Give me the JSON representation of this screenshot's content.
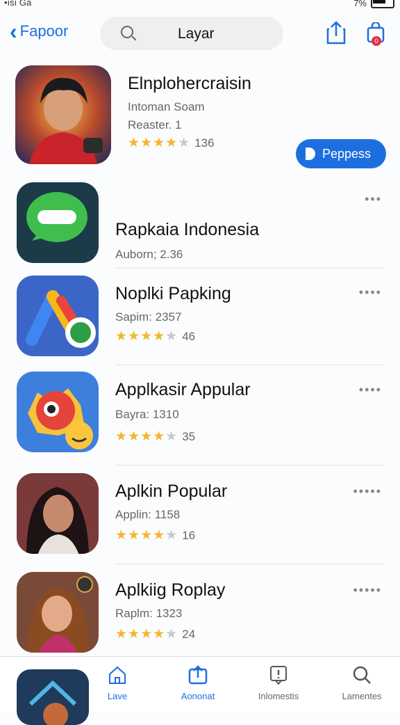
{
  "status": {
    "left_text": "•ısı Ga",
    "battery": "7%"
  },
  "nav": {
    "back_label": "Fapoor",
    "search_text": "Layar",
    "badge": "0"
  },
  "featured": {
    "title": "Elnplohercraisin",
    "subtitle": "Intoman Soam",
    "meta": "Reaster. 1",
    "rating_count": "136",
    "cta_label": "Peppess",
    "stars": 4
  },
  "apps": [
    {
      "title": "Rapkaia Indonesia",
      "subtitle": "Auborn; 2.36",
      "rating_count": "",
      "stars": 0,
      "more": "•••"
    },
    {
      "title": "Noplki Papking",
      "subtitle": "Sapim: 2357",
      "rating_count": "46",
      "stars": 4,
      "more": "••••"
    },
    {
      "title": "Applkasir Appular",
      "subtitle": "Bayra: 1310",
      "rating_count": "35",
      "stars": 4,
      "more": "••••"
    },
    {
      "title": "Aplkin Popular",
      "subtitle": "Applin: 1158",
      "rating_count": "16",
      "stars": 4,
      "more": "•••••"
    },
    {
      "title": "Aplkiig Roplay",
      "subtitle": "Raplm: 1323",
      "rating_count": "24",
      "stars": 4,
      "more": "•••••"
    }
  ],
  "tabs": [
    {
      "label": "Lave",
      "icon": "home-icon"
    },
    {
      "label": "Aononat",
      "icon": "share-icon"
    },
    {
      "label": "Inlomestis",
      "icon": "alert-icon"
    },
    {
      "label": "Lamentes",
      "icon": "search-icon"
    }
  ],
  "colors": {
    "accent": "#1d6fe0",
    "star": "#f3b62b",
    "badge": "#e3324a"
  }
}
